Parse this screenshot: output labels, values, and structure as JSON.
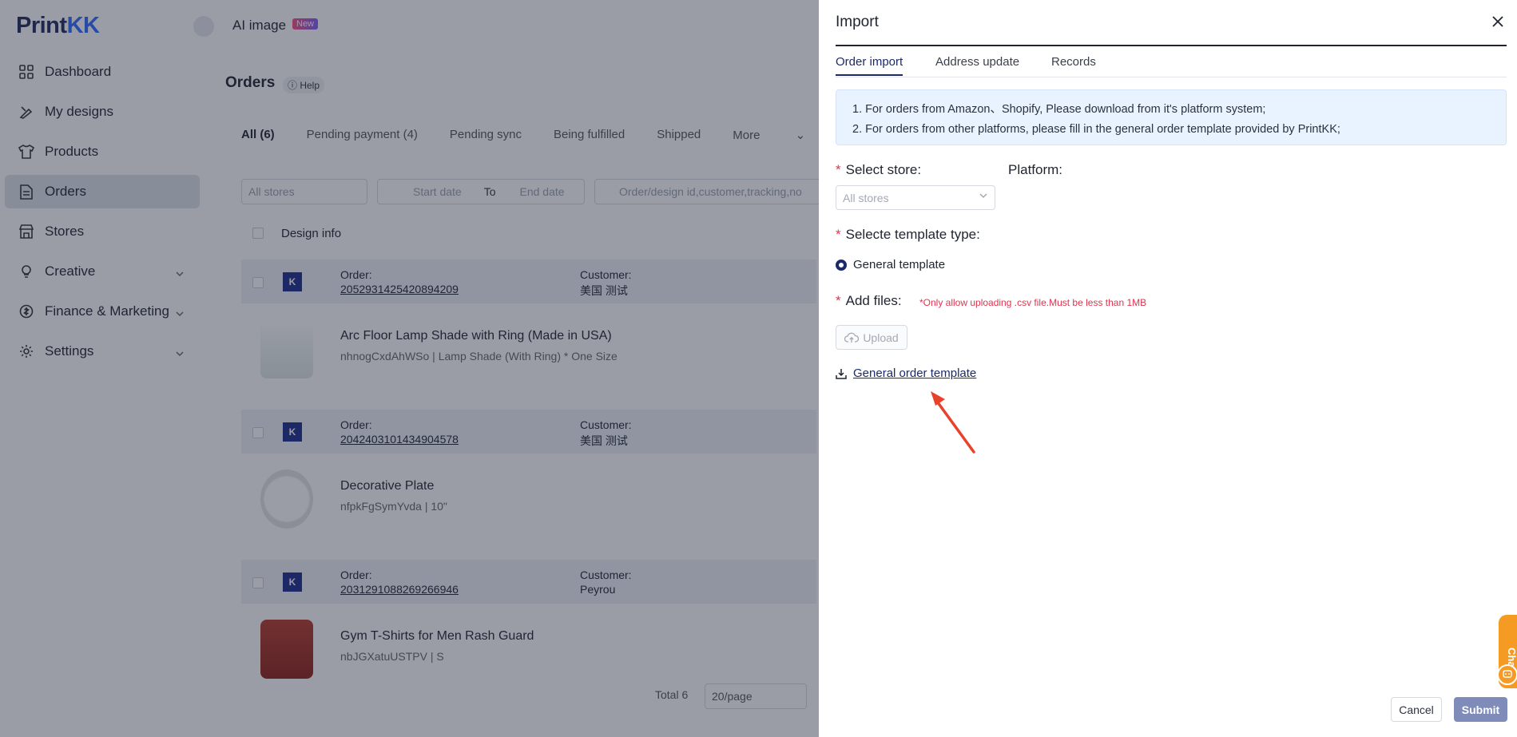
{
  "brand": {
    "logo_main": "Print",
    "logo_accent": "KK"
  },
  "sidebar": {
    "items": [
      {
        "label": "Dashboard",
        "icon": "grid-icon"
      },
      {
        "label": "My designs",
        "icon": "design-icon"
      },
      {
        "label": "Products",
        "icon": "shirt-icon"
      },
      {
        "label": "Orders",
        "icon": "document-icon",
        "active": true
      },
      {
        "label": "Stores",
        "icon": "store-icon"
      },
      {
        "label": "Creative",
        "icon": "creative-icon",
        "expandable": true
      },
      {
        "label": "Finance & Marketing",
        "icon": "finance-icon",
        "expandable": true
      },
      {
        "label": "Settings",
        "icon": "gear-icon",
        "expandable": true
      }
    ]
  },
  "topbar": {
    "ai_label": "AI image",
    "new_badge": "New"
  },
  "orders_page": {
    "title": "Orders",
    "help": "Help",
    "tabs": [
      "All (6)",
      "Pending payment (4)",
      "Pending sync",
      "Being fulfilled",
      "Shipped",
      "More"
    ],
    "filters": {
      "stores_placeholder": "All stores",
      "start_date": "Start date",
      "to": "To",
      "end_date": "End date",
      "search_placeholder": "Order/design id,customer,tracking,no"
    },
    "table_header": "Design info",
    "orders": [
      {
        "order_label": "Order:",
        "order_id": "2052931425420894209",
        "customer_label": "Customer:",
        "customer": "美国 测试",
        "product_name": "Arc Floor Lamp Shade with Ring (Made in USA)",
        "product_sub": "nhnogCxdAhWSo | Lamp Shade (With Ring) * One Size"
      },
      {
        "order_label": "Order:",
        "order_id": "2042403101434904578",
        "customer_label": "Customer:",
        "customer": "美国 测试",
        "product_name": "Decorative Plate",
        "product_sub": "nfpkFgSymYvda | 10\""
      },
      {
        "order_label": "Order:",
        "order_id": "2031291088269266946",
        "customer_label": "Customer:",
        "customer": "Peyrou",
        "product_name": "Gym T-Shirts for Men Rash Guard",
        "product_sub": "nbJGXatuUSTPV | S"
      }
    ],
    "pager": {
      "total": "Total 6",
      "page_size": "20/page"
    }
  },
  "drawer": {
    "title": "Import",
    "tabs": [
      "Order import",
      "Address update",
      "Records"
    ],
    "active_tab": "Order import",
    "notice": [
      "1. For orders from Amazon、Shopify, Please download from it's platform system;",
      "2. For orders from other platforms, please fill in the general order template provided by PrintKK;"
    ],
    "required_mark": "*",
    "select_store_label": "Select store:",
    "platform_label": "Platform:",
    "store_placeholder": "All stores",
    "template_type_label": "Selecte template type:",
    "template_option": "General template",
    "add_files_label": "Add files:",
    "files_hint": "*Only allow uploading .csv file.Must be less than 1MB",
    "upload_label": "Upload",
    "download_link": "General order template",
    "cancel": "Cancel",
    "submit": "Submit",
    "chat": "Chat"
  },
  "colors": {
    "accent": "#1c2a6b",
    "required": "#e0334e",
    "notice_bg": "#e9f2ff",
    "submit_bg": "#7f8bb8",
    "chat": "#f59a23",
    "annotation_arrow": "#e8432a"
  }
}
